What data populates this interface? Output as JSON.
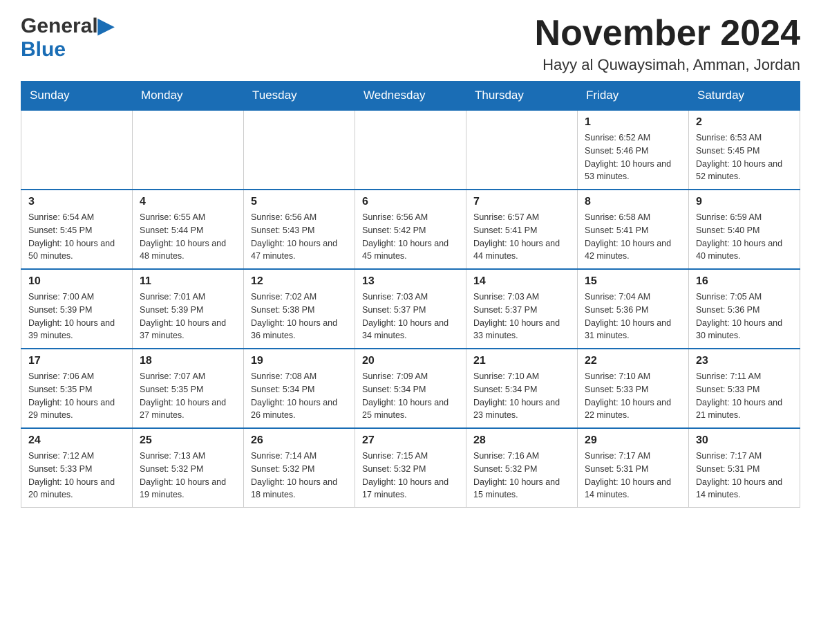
{
  "logo": {
    "text_general": "General",
    "text_blue": "Blue",
    "triangle": "▶"
  },
  "header": {
    "month_year": "November 2024",
    "location": "Hayy al Quwaysimah, Amman, Jordan"
  },
  "weekdays": [
    "Sunday",
    "Monday",
    "Tuesday",
    "Wednesday",
    "Thursday",
    "Friday",
    "Saturday"
  ],
  "weeks": [
    [
      {
        "day": "",
        "sunrise": "",
        "sunset": "",
        "daylight": ""
      },
      {
        "day": "",
        "sunrise": "",
        "sunset": "",
        "daylight": ""
      },
      {
        "day": "",
        "sunrise": "",
        "sunset": "",
        "daylight": ""
      },
      {
        "day": "",
        "sunrise": "",
        "sunset": "",
        "daylight": ""
      },
      {
        "day": "",
        "sunrise": "",
        "sunset": "",
        "daylight": ""
      },
      {
        "day": "1",
        "sunrise": "Sunrise: 6:52 AM",
        "sunset": "Sunset: 5:46 PM",
        "daylight": "Daylight: 10 hours and 53 minutes."
      },
      {
        "day": "2",
        "sunrise": "Sunrise: 6:53 AM",
        "sunset": "Sunset: 5:45 PM",
        "daylight": "Daylight: 10 hours and 52 minutes."
      }
    ],
    [
      {
        "day": "3",
        "sunrise": "Sunrise: 6:54 AM",
        "sunset": "Sunset: 5:45 PM",
        "daylight": "Daylight: 10 hours and 50 minutes."
      },
      {
        "day": "4",
        "sunrise": "Sunrise: 6:55 AM",
        "sunset": "Sunset: 5:44 PM",
        "daylight": "Daylight: 10 hours and 48 minutes."
      },
      {
        "day": "5",
        "sunrise": "Sunrise: 6:56 AM",
        "sunset": "Sunset: 5:43 PM",
        "daylight": "Daylight: 10 hours and 47 minutes."
      },
      {
        "day": "6",
        "sunrise": "Sunrise: 6:56 AM",
        "sunset": "Sunset: 5:42 PM",
        "daylight": "Daylight: 10 hours and 45 minutes."
      },
      {
        "day": "7",
        "sunrise": "Sunrise: 6:57 AM",
        "sunset": "Sunset: 5:41 PM",
        "daylight": "Daylight: 10 hours and 44 minutes."
      },
      {
        "day": "8",
        "sunrise": "Sunrise: 6:58 AM",
        "sunset": "Sunset: 5:41 PM",
        "daylight": "Daylight: 10 hours and 42 minutes."
      },
      {
        "day": "9",
        "sunrise": "Sunrise: 6:59 AM",
        "sunset": "Sunset: 5:40 PM",
        "daylight": "Daylight: 10 hours and 40 minutes."
      }
    ],
    [
      {
        "day": "10",
        "sunrise": "Sunrise: 7:00 AM",
        "sunset": "Sunset: 5:39 PM",
        "daylight": "Daylight: 10 hours and 39 minutes."
      },
      {
        "day": "11",
        "sunrise": "Sunrise: 7:01 AM",
        "sunset": "Sunset: 5:39 PM",
        "daylight": "Daylight: 10 hours and 37 minutes."
      },
      {
        "day": "12",
        "sunrise": "Sunrise: 7:02 AM",
        "sunset": "Sunset: 5:38 PM",
        "daylight": "Daylight: 10 hours and 36 minutes."
      },
      {
        "day": "13",
        "sunrise": "Sunrise: 7:03 AM",
        "sunset": "Sunset: 5:37 PM",
        "daylight": "Daylight: 10 hours and 34 minutes."
      },
      {
        "day": "14",
        "sunrise": "Sunrise: 7:03 AM",
        "sunset": "Sunset: 5:37 PM",
        "daylight": "Daylight: 10 hours and 33 minutes."
      },
      {
        "day": "15",
        "sunrise": "Sunrise: 7:04 AM",
        "sunset": "Sunset: 5:36 PM",
        "daylight": "Daylight: 10 hours and 31 minutes."
      },
      {
        "day": "16",
        "sunrise": "Sunrise: 7:05 AM",
        "sunset": "Sunset: 5:36 PM",
        "daylight": "Daylight: 10 hours and 30 minutes."
      }
    ],
    [
      {
        "day": "17",
        "sunrise": "Sunrise: 7:06 AM",
        "sunset": "Sunset: 5:35 PM",
        "daylight": "Daylight: 10 hours and 29 minutes."
      },
      {
        "day": "18",
        "sunrise": "Sunrise: 7:07 AM",
        "sunset": "Sunset: 5:35 PM",
        "daylight": "Daylight: 10 hours and 27 minutes."
      },
      {
        "day": "19",
        "sunrise": "Sunrise: 7:08 AM",
        "sunset": "Sunset: 5:34 PM",
        "daylight": "Daylight: 10 hours and 26 minutes."
      },
      {
        "day": "20",
        "sunrise": "Sunrise: 7:09 AM",
        "sunset": "Sunset: 5:34 PM",
        "daylight": "Daylight: 10 hours and 25 minutes."
      },
      {
        "day": "21",
        "sunrise": "Sunrise: 7:10 AM",
        "sunset": "Sunset: 5:34 PM",
        "daylight": "Daylight: 10 hours and 23 minutes."
      },
      {
        "day": "22",
        "sunrise": "Sunrise: 7:10 AM",
        "sunset": "Sunset: 5:33 PM",
        "daylight": "Daylight: 10 hours and 22 minutes."
      },
      {
        "day": "23",
        "sunrise": "Sunrise: 7:11 AM",
        "sunset": "Sunset: 5:33 PM",
        "daylight": "Daylight: 10 hours and 21 minutes."
      }
    ],
    [
      {
        "day": "24",
        "sunrise": "Sunrise: 7:12 AM",
        "sunset": "Sunset: 5:33 PM",
        "daylight": "Daylight: 10 hours and 20 minutes."
      },
      {
        "day": "25",
        "sunrise": "Sunrise: 7:13 AM",
        "sunset": "Sunset: 5:32 PM",
        "daylight": "Daylight: 10 hours and 19 minutes."
      },
      {
        "day": "26",
        "sunrise": "Sunrise: 7:14 AM",
        "sunset": "Sunset: 5:32 PM",
        "daylight": "Daylight: 10 hours and 18 minutes."
      },
      {
        "day": "27",
        "sunrise": "Sunrise: 7:15 AM",
        "sunset": "Sunset: 5:32 PM",
        "daylight": "Daylight: 10 hours and 17 minutes."
      },
      {
        "day": "28",
        "sunrise": "Sunrise: 7:16 AM",
        "sunset": "Sunset: 5:32 PM",
        "daylight": "Daylight: 10 hours and 15 minutes."
      },
      {
        "day": "29",
        "sunrise": "Sunrise: 7:17 AM",
        "sunset": "Sunset: 5:31 PM",
        "daylight": "Daylight: 10 hours and 14 minutes."
      },
      {
        "day": "30",
        "sunrise": "Sunrise: 7:17 AM",
        "sunset": "Sunset: 5:31 PM",
        "daylight": "Daylight: 10 hours and 14 minutes."
      }
    ]
  ]
}
